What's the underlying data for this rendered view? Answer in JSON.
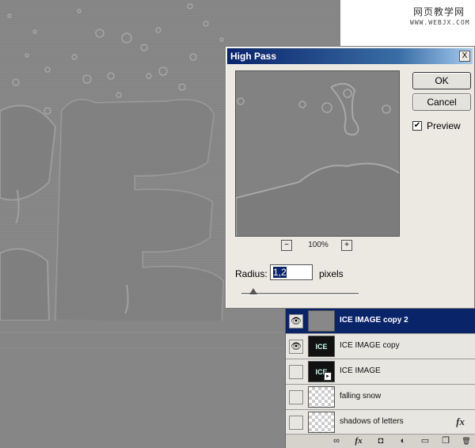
{
  "watermark": {
    "title": "网页教学网",
    "url": "WWW.WEBJX.COM"
  },
  "dialog": {
    "title": "High Pass",
    "close_label": "X",
    "ok_label": "OK",
    "cancel_label": "Cancel",
    "preview_label": "Preview",
    "preview_checked": true,
    "check_mark": "✔",
    "zoom_minus": "−",
    "zoom_plus": "+",
    "zoom_value": "100%",
    "radius_label": "Radius:",
    "radius_value": "1,2",
    "radius_unit": "pixels"
  },
  "layers": [
    {
      "name": "ICE IMAGE copy 2",
      "visible": true,
      "selected": true,
      "thumb": "gray"
    },
    {
      "name": "ICE IMAGE copy",
      "visible": true,
      "selected": false,
      "thumb": "ice",
      "thumb_text": "ICE"
    },
    {
      "name": "ICE IMAGE",
      "visible": false,
      "selected": false,
      "thumb": "ice",
      "thumb_text": "ICE"
    },
    {
      "name": "falling snow",
      "visible": false,
      "selected": false,
      "thumb": "transparent"
    },
    {
      "name": "shadows of letters",
      "visible": false,
      "selected": false,
      "thumb": "transparent",
      "fx": "fx"
    }
  ],
  "layer_eye_glyph": "👁",
  "bottom_bar": {
    "link": "∞",
    "fx": "fx",
    "mask": "◘",
    "adjustment": "◐",
    "group": "▭",
    "new": "❐",
    "delete": "🗑"
  },
  "colors": {
    "titlebar": "#0a246a",
    "selected_layer": "#0a246a",
    "canvas": "#858585"
  }
}
